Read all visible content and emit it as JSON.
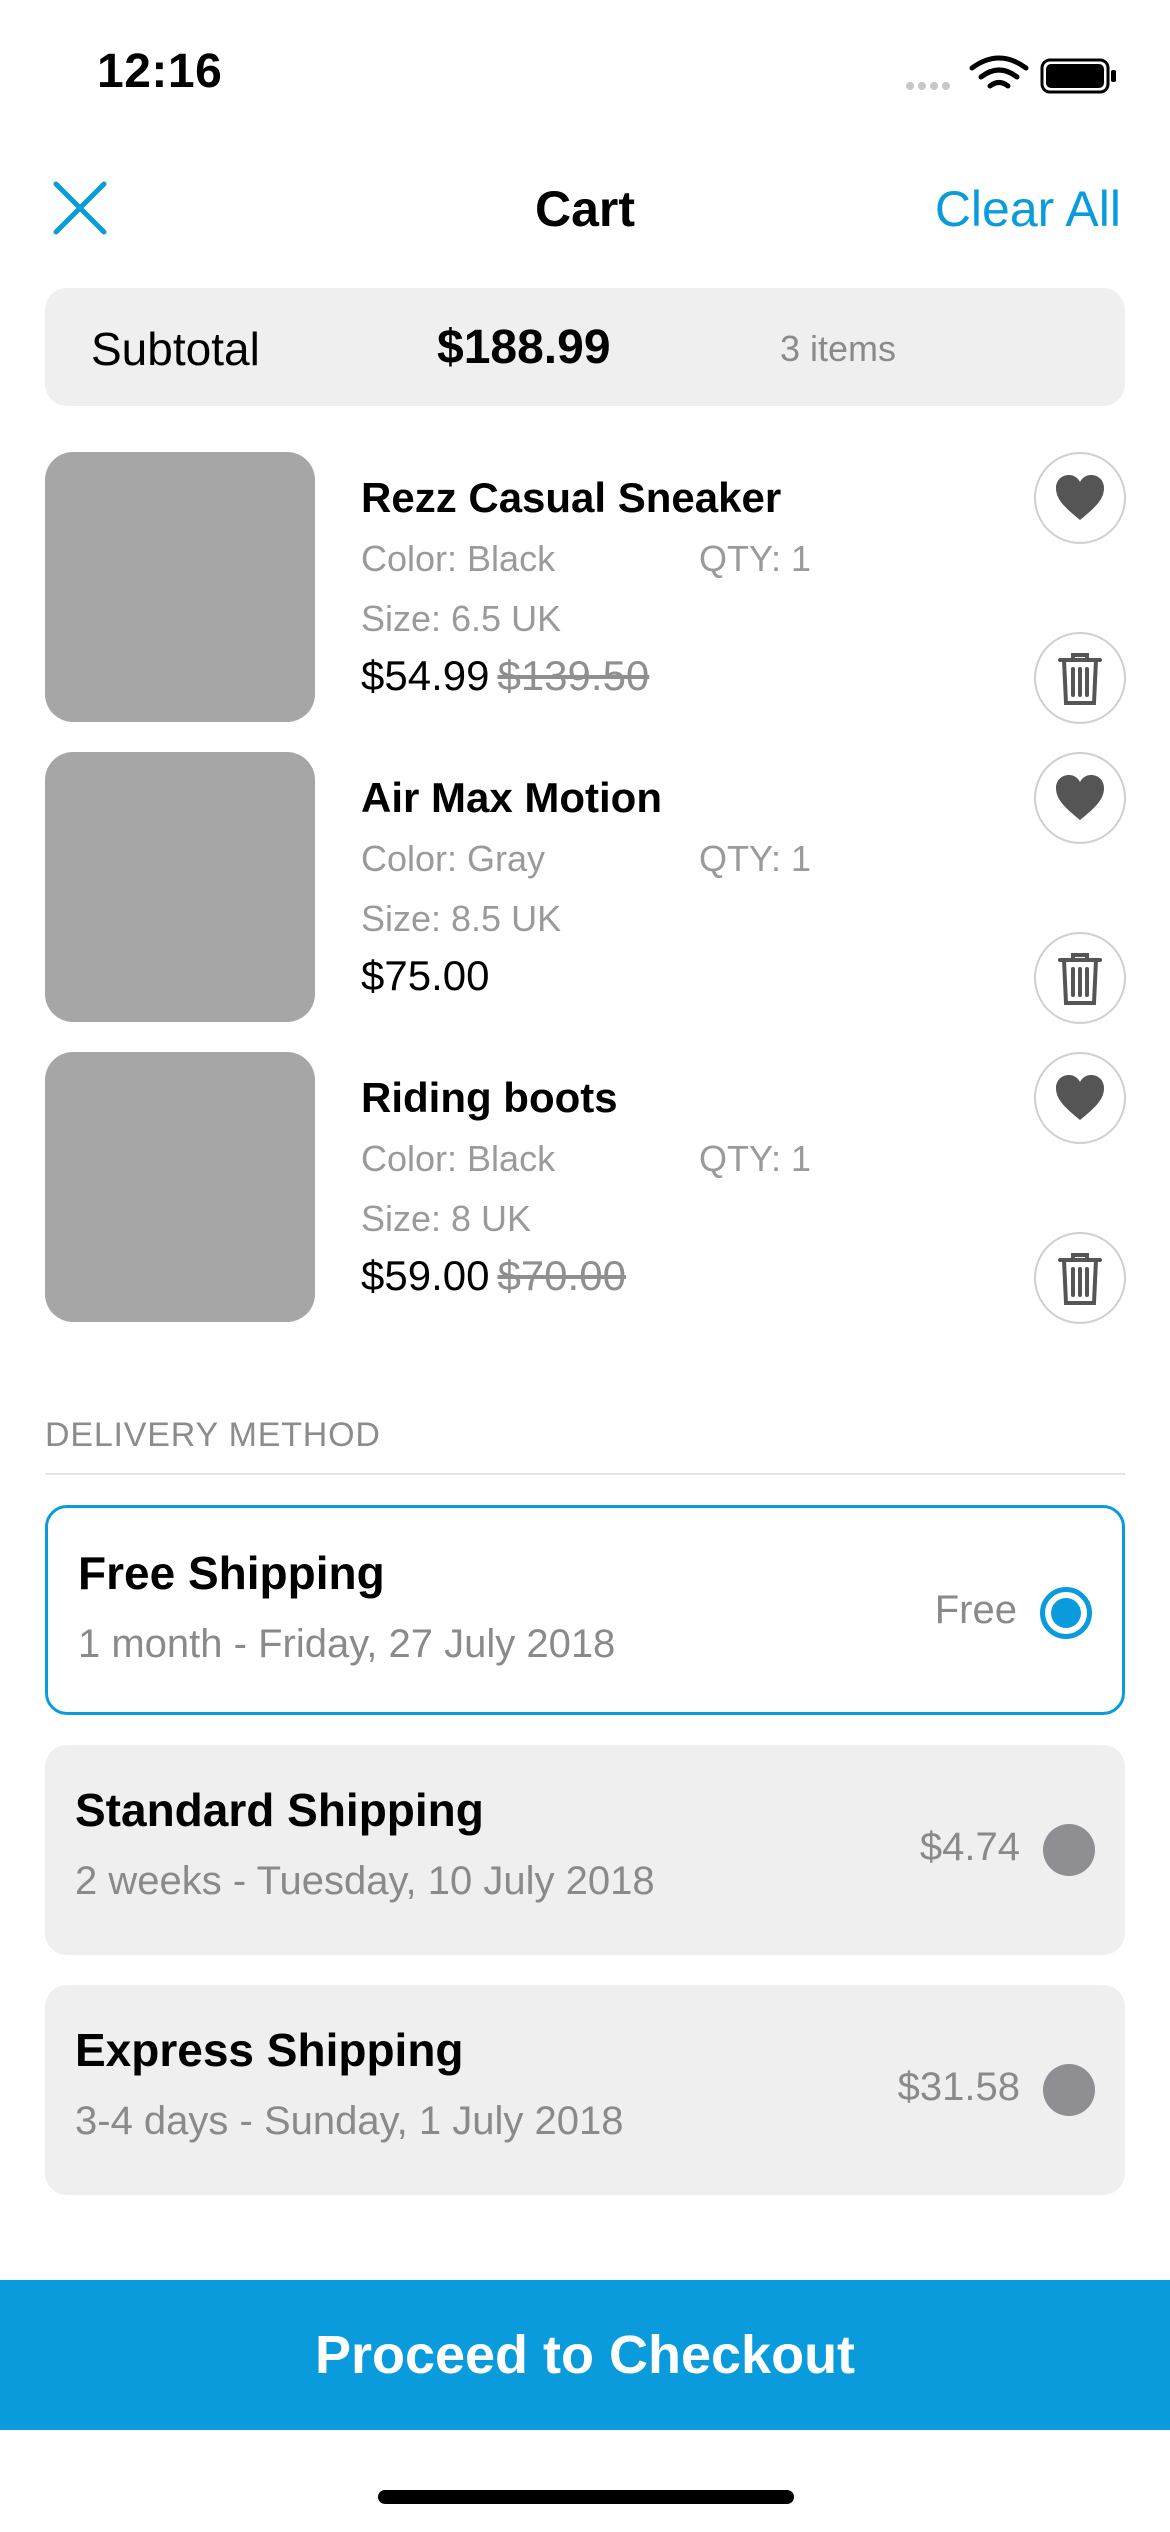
{
  "status_bar": {
    "time": "12:16"
  },
  "nav": {
    "title": "Cart",
    "clear_all": "Clear All"
  },
  "subtotal": {
    "label": "Subtotal",
    "value": "$188.99",
    "items": "3 items"
  },
  "cart_items": [
    {
      "name": "Rezz Casual Sneaker",
      "color": "Color: Black",
      "qty": "QTY: 1",
      "size": "Size: 6.5 UK",
      "price": "$54.99",
      "old_price": "$139.50"
    },
    {
      "name": "Air Max Motion",
      "color": "Color: Gray",
      "qty": "QTY: 1",
      "size": "Size: 8.5 UK",
      "price": "$75.00",
      "old_price": ""
    },
    {
      "name": "Riding boots",
      "color": "Color: Black",
      "qty": "QTY: 1",
      "size": "Size: 8 UK",
      "price": "$59.00",
      "old_price": "$70.00"
    }
  ],
  "delivery": {
    "header": "DELIVERY METHOD",
    "options": [
      {
        "title": "Free Shipping",
        "subtitle": "1 month - Friday, 27 July 2018",
        "price": "Free",
        "selected": true
      },
      {
        "title": "Standard Shipping",
        "subtitle": "2 weeks - Tuesday, 10 July 2018",
        "price": "$4.74",
        "selected": false
      },
      {
        "title": "Express Shipping",
        "subtitle": "3-4 days - Sunday, 1 July 2018",
        "price": "$31.58",
        "selected": false
      }
    ]
  },
  "checkout": {
    "label": "Proceed to Checkout"
  },
  "colors": {
    "accent": "#0a9bdc",
    "placeholder": "#a6a6a6",
    "panel": "#efefef"
  },
  "icons": {
    "close": "close-icon",
    "favorite": "heart-icon",
    "delete": "trash-icon",
    "wifi": "wifi-icon",
    "battery": "battery-icon",
    "signal": "signal-icon"
  }
}
